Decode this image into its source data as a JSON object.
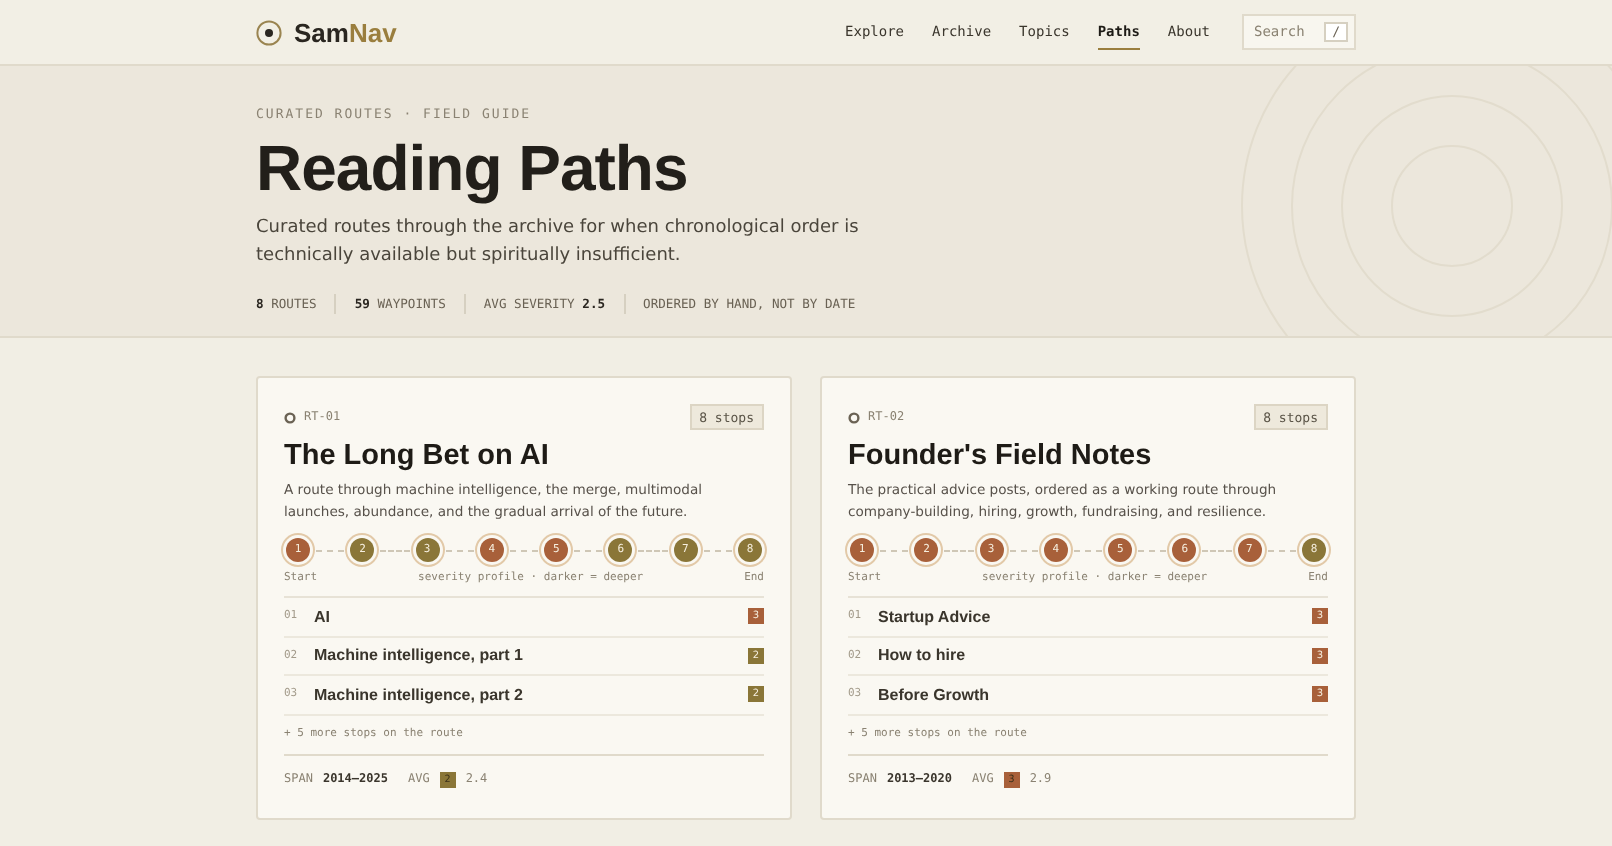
{
  "brand": {
    "name": "Sam",
    "accent": "Nav"
  },
  "nav": [
    {
      "label": "Explore",
      "selected": false
    },
    {
      "label": "Archive",
      "selected": false
    },
    {
      "label": "Topics",
      "selected": false
    },
    {
      "label": "Paths",
      "selected": true
    },
    {
      "label": "About",
      "selected": false
    }
  ],
  "search": {
    "placeholder": "Search",
    "key": "/"
  },
  "hero": {
    "eyebrow": "CURATED ROUTES · FIELD GUIDE",
    "title": "Reading Paths",
    "lede": "Curated routes through the archive for when chronological order is technically available but spiritually insufficient.",
    "stats": [
      {
        "value": "8",
        "label": "ROUTES"
      },
      {
        "value": "59",
        "label": "WAYPOINTS"
      },
      {
        "before": "AVG SEVERITY",
        "value": "2.5"
      },
      {
        "label": "ORDERED BY HAND, NOT BY DATE"
      }
    ]
  },
  "routes": [
    {
      "id": "RT-01",
      "count": "8 stops",
      "title": "The Long Bet on AI",
      "description": "A route through machine intelligence, the merge, multimodal launches, abundance, and the gradual arrival of the future.",
      "stops": [
        {
          "label": "1",
          "color": "#a8603a"
        },
        {
          "label": "2",
          "color": "#8a7638"
        },
        {
          "label": "3",
          "color": "#8a7638"
        },
        {
          "label": "4",
          "color": "#a8603a"
        },
        {
          "label": "5",
          "color": "#a8603a"
        },
        {
          "label": "6",
          "color": "#8a7638"
        },
        {
          "label": "7",
          "color": "#8a7638"
        },
        {
          "label": "8",
          "color": "#8a7638"
        }
      ],
      "start": "Start",
      "legend": "severity profile · darker = deeper",
      "end": "End",
      "items": [
        {
          "num": "01",
          "title": "AI",
          "severity": "3",
          "color": "#a8603a"
        },
        {
          "num": "02",
          "title": "Machine intelligence, part 1",
          "severity": "2",
          "color": "#8a7638"
        },
        {
          "num": "03",
          "title": "Machine intelligence, part 2",
          "severity": "2",
          "color": "#8a7638"
        }
      ],
      "more": "+ 5 more stops on the route",
      "span_label": "SPAN",
      "span": "2014–2025",
      "avg_label": "AVG",
      "avg_badge": {
        "label": "2",
        "color": "#8a7638"
      },
      "avg": "2.4"
    },
    {
      "id": "RT-02",
      "count": "8 stops",
      "title": "Founder's Field Notes",
      "description": "The practical advice posts, ordered as a working route through company-building, hiring, growth, fundraising, and resilience.",
      "stops": [
        {
          "label": "1",
          "color": "#a8603a"
        },
        {
          "label": "2",
          "color": "#a8603a"
        },
        {
          "label": "3",
          "color": "#a8603a"
        },
        {
          "label": "4",
          "color": "#a8603a"
        },
        {
          "label": "5",
          "color": "#a8603a"
        },
        {
          "label": "6",
          "color": "#a8603a"
        },
        {
          "label": "7",
          "color": "#a8603a"
        },
        {
          "label": "8",
          "color": "#8a7638"
        }
      ],
      "start": "Start",
      "legend": "severity profile · darker = deeper",
      "end": "End",
      "items": [
        {
          "num": "01",
          "title": "Startup Advice",
          "severity": "3",
          "color": "#a8603a"
        },
        {
          "num": "02",
          "title": "How to hire",
          "severity": "3",
          "color": "#a8603a"
        },
        {
          "num": "03",
          "title": "Before Growth",
          "severity": "3",
          "color": "#a8603a"
        }
      ],
      "more": "+ 5 more stops on the route",
      "span_label": "SPAN",
      "span": "2013–2020",
      "avg_label": "AVG",
      "avg_badge": {
        "label": "3",
        "color": "#a8603a"
      },
      "avg": "2.9"
    }
  ]
}
